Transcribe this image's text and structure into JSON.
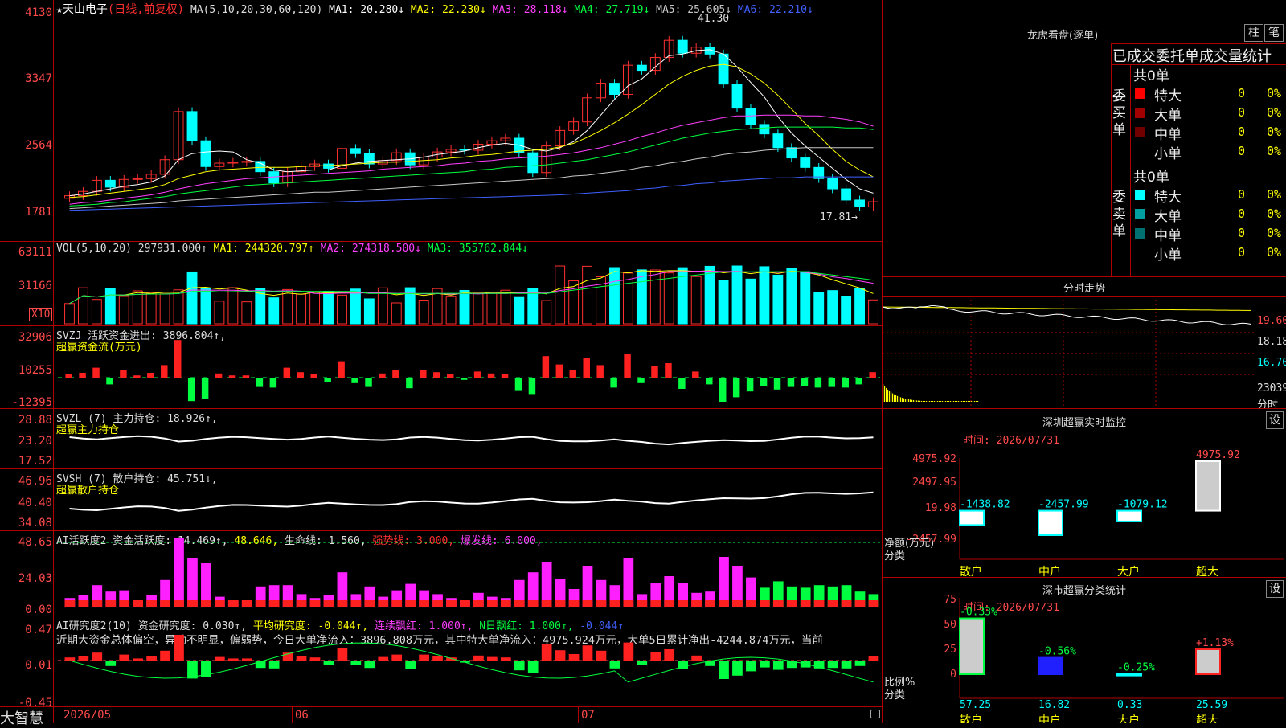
{
  "stock": {
    "star": "★",
    "name": "天山电子",
    "mode": "(日线,前复权)"
  },
  "ma_header": {
    "prefix": "MA(5,10,20,30,60,120)",
    "items": [
      {
        "label": "MA1: 20.280↓",
        "color": "#ffffff"
      },
      {
        "label": "MA2: 22.230↓",
        "color": "#ffff00"
      },
      {
        "label": "MA3: 28.118↓",
        "color": "#ff40ff"
      },
      {
        "label": "MA4: 27.719↓",
        "color": "#00ff40"
      },
      {
        "label": "MA5: 25.605↓",
        "color": "#c8c8c8"
      },
      {
        "label": "MA6: 22.210↓",
        "color": "#4060ff"
      }
    ]
  },
  "price_axis": [
    "4130",
    "3347",
    "2564",
    "1781"
  ],
  "price_annot": {
    "high": "41.30",
    "low": "17.81→"
  },
  "vol_header": {
    "prefix": "VOL(5,10,20)",
    "value": "297931.000↑",
    "items": [
      {
        "label": "MA1: 244320.797↑",
        "color": "#ffff00"
      },
      {
        "label": "MA2: 274318.500↓",
        "color": "#ff40ff"
      },
      {
        "label": "MA3: 355762.844↓",
        "color": "#00ff40"
      }
    ]
  },
  "vol_axis": [
    "63111",
    "31166"
  ],
  "vol_unit": "X10",
  "svzj": {
    "title": "SVZJ  活跃资金进出: 3896.804↑,",
    "sub": "超赢资金流(万元)",
    "axis": [
      "32906",
      "10255",
      "-12395"
    ]
  },
  "svzl": {
    "title": "SVZL (7) 主力持仓: 18.926↑,",
    "sub": "超赢主力持仓",
    "axis": [
      "28.88",
      "23.20",
      "17.52"
    ]
  },
  "svsh": {
    "title": "SVSH (7) 散户持仓: 45.751↓,",
    "sub": "超赢散户持仓",
    "axis": [
      "46.96",
      "40.40",
      "34.08"
    ]
  },
  "ai2": {
    "items": [
      {
        "label": "AI活跃度2 资金活跃度: 14.469↑,",
        "color": "#dddddd"
      },
      {
        "label": "48.646,",
        "color": "#ffff00"
      },
      {
        "label": "生命线: 1.560,",
        "color": "#dddddd"
      },
      {
        "label": "强势线: 3.000,",
        "color": "#ff3030"
      },
      {
        "label": "爆发线: 6.000,",
        "color": "#ff40ff"
      }
    ],
    "axis": [
      "48.65",
      "24.03",
      "0.00"
    ]
  },
  "ai_res": {
    "items": [
      {
        "label": "AI研究度2(10) 资金研究度: 0.030↑,",
        "color": "#dddddd"
      },
      {
        "label": "平均研究度: -0.044↑,",
        "color": "#ffff00"
      },
      {
        "label": "连续飘红: 1.000↑,",
        "color": "#ff40ff"
      },
      {
        "label": "N日飘红: 1.000↑,",
        "color": "#00ff40"
      },
      {
        "label": "-0.044↑",
        "color": "#4060ff"
      }
    ],
    "text": "近期大资金总体偏空，异动不明显，偏弱势，今日大单净流入：3896.808万元，其中特大单净流入：4975.924万元，大单5日累计净出-4244.874万元，当前",
    "axis": [
      "0.47",
      "0.01",
      "-0.45"
    ]
  },
  "bottom": {
    "brand": "大智慧",
    "dates": [
      "2026/05",
      "06",
      "07"
    ]
  },
  "lhb": {
    "title": "龙虎看盘(逐单)",
    "btn1": "柱",
    "btn2": "笔",
    "subtitle": "已成交委托单成交量统计",
    "buy": {
      "side": "委买单",
      "total": "共0单",
      "rows": [
        {
          "label": "特大",
          "val": "0",
          "pct": "0%",
          "color": "#ff0000"
        },
        {
          "label": "大单",
          "val": "0",
          "pct": "0%",
          "color": "#a00000"
        },
        {
          "label": "中单",
          "val": "0",
          "pct": "0%",
          "color": "#700000"
        },
        {
          "label": "小单",
          "val": "0",
          "pct": "0%",
          "color": "#000000"
        }
      ]
    },
    "sell": {
      "side": "委卖单",
      "total": "共0单",
      "rows": [
        {
          "label": "特大",
          "val": "0",
          "pct": "0%",
          "color": "#00ffff"
        },
        {
          "label": "大单",
          "val": "0",
          "pct": "0%",
          "color": "#00a0a0"
        },
        {
          "label": "中单",
          "val": "0",
          "pct": "0%",
          "color": "#007070"
        },
        {
          "label": "小单",
          "val": "0",
          "pct": "0%",
          "color": "#000000"
        }
      ]
    }
  },
  "intraday": {
    "title": "分时走势",
    "axis": [
      "19.60",
      "18.18",
      "16.70"
    ],
    "vol": "23039",
    "vol_label": "分时"
  },
  "sz_monitor": {
    "title": "深圳超赢实时监控",
    "btn": "设",
    "time": "时间: 2026/07/31",
    "axis": [
      "4975.92",
      "2497.95",
      "19.98",
      "-2457.99"
    ],
    "ylabel": "净额(万元)",
    "xlabel": "分类",
    "bars": [
      {
        "cat": "散户",
        "value": -1438.82,
        "label": "-1438.82"
      },
      {
        "cat": "中户",
        "value": -2457.99,
        "label": "-2457.99"
      },
      {
        "cat": "大户",
        "value": -1079.12,
        "label": "-1079.12"
      },
      {
        "cat": "超大",
        "value": 4975.92,
        "label": "4975.92"
      }
    ]
  },
  "sz_class": {
    "title": "深市超赢分类统计",
    "btn": "设",
    "time": "时间: 2026/07/31",
    "axis": [
      "75",
      "50",
      "25",
      "0"
    ],
    "ylabel": "比例%",
    "xlabel": "分类",
    "bars": [
      {
        "cat": "散户",
        "value": 57.25,
        "label": "57.25",
        "chg": "-0.33%"
      },
      {
        "cat": "中户",
        "value": 16.82,
        "label": "16.82",
        "chg": "-0.56%"
      },
      {
        "cat": "大户",
        "value": 0.33,
        "label": "0.33",
        "chg": "-0.25%"
      },
      {
        "cat": "超大",
        "value": 25.59,
        "label": "25.59",
        "chg": "+1.13%"
      }
    ]
  },
  "chart_data": [
    {
      "type": "bar",
      "title": "深圳超赢实时监控",
      "ylabel": "净额(万元)",
      "xlabel": "分类",
      "categories": [
        "散户",
        "中户",
        "大户",
        "超大"
      ],
      "values": [
        -1438.82,
        -2457.99,
        -1079.12,
        4975.92
      ],
      "ylim": [
        -2457.99,
        4975.92
      ]
    },
    {
      "type": "bar",
      "title": "深市超赢分类统计",
      "ylabel": "比例%",
      "xlabel": "分类",
      "categories": [
        "散户",
        "中户",
        "大户",
        "超大"
      ],
      "values": [
        57.25,
        16.82,
        0.33,
        25.59
      ],
      "ylim": [
        0,
        75
      ]
    },
    {
      "type": "candlestick",
      "price_axis_ticks": [
        41.3,
        33.47,
        25.64,
        17.81
      ],
      "close": [
        20.0,
        20.5,
        21.8,
        21.0,
        21.9,
        22.0,
        22.5,
        24.2,
        29.8,
        26.4,
        23.4,
        23.8,
        23.9,
        24.0,
        22.8,
        21.5,
        22.8,
        23.4,
        23.7,
        23.2,
        25.5,
        24.9,
        23.7,
        24.1,
        25.0,
        23.6,
        24.5,
        25.1,
        25.4,
        25.3,
        26.0,
        26.4,
        26.7,
        25.0,
        22.7,
        25.8,
        27.6,
        28.6,
        31.4,
        33.1,
        31.8,
        35.2,
        34.6,
        36.1,
        38.1,
        36.6,
        37.3,
        36.5,
        33.0,
        30.2,
        28.3,
        27.2,
        25.6,
        24.4,
        23.3,
        22.0,
        20.8,
        19.5,
        18.7,
        19.3
      ],
      "ma1": [
        20.0,
        20.2,
        20.5,
        20.8,
        21.1,
        21.3,
        21.6,
        22.3,
        24.2,
        24.9,
        25.1,
        25.2,
        25.1,
        24.2,
        23.8,
        23.0,
        22.8,
        22.9,
        23.0,
        23.0,
        23.5,
        23.8,
        24.0,
        24.1,
        24.2,
        24.3,
        24.5,
        24.8,
        25.0,
        25.2,
        25.6,
        25.9,
        26.1,
        25.9,
        25.4,
        25.2,
        25.6,
        26.3,
        27.6,
        29.4,
        31.2,
        32.8,
        33.6,
        35.0,
        36.3,
        36.5,
        36.9,
        37.0,
        36.5,
        35.0,
        33.2,
        31.5,
        29.2,
        27.3,
        25.8,
        24.5,
        23.2,
        21.9,
        20.8,
        20.3
      ],
      "ma2": [
        19.8,
        19.9,
        20.1,
        20.3,
        20.5,
        20.7,
        20.9,
        21.3,
        22.0,
        22.4,
        22.8,
        23.0,
        23.1,
        23.2,
        23.3,
        23.3,
        23.3,
        23.4,
        23.5,
        23.5,
        23.6,
        23.7,
        23.8,
        23.9,
        23.9,
        24.0,
        24.1,
        24.2,
        24.4,
        24.5,
        24.7,
        24.8,
        25.0,
        25.2,
        25.3,
        25.4,
        25.7,
        26.1,
        26.8,
        27.6,
        28.5,
        29.5,
        30.6,
        31.8,
        33.0,
        33.9,
        34.6,
        35.1,
        35.3,
        35.0,
        34.2,
        33.1,
        31.7,
        30.1,
        28.4,
        27.0,
        25.4,
        24.0,
        23.0,
        22.2
      ],
      "ma3": [
        19.0,
        19.2,
        19.3,
        19.5,
        19.7,
        19.9,
        20.1,
        20.4,
        20.8,
        21.1,
        21.4,
        21.6,
        21.8,
        22.0,
        22.1,
        22.2,
        22.3,
        22.4,
        22.5,
        22.6,
        22.7,
        22.8,
        22.9,
        23.1,
        23.2,
        23.3,
        23.4,
        23.5,
        23.7,
        23.8,
        24.0,
        24.1,
        24.3,
        24.4,
        24.5,
        24.6,
        24.8,
        25.0,
        25.3,
        25.6,
        26.0,
        26.4,
        26.9,
        27.3,
        27.8,
        28.2,
        28.5,
        28.8,
        29.1,
        29.3,
        29.3,
        29.4,
        29.4,
        29.4,
        29.3,
        29.3,
        29.1,
        28.9,
        28.6,
        28.1
      ],
      "ma4": [
        18.8,
        18.9,
        19.0,
        19.2,
        19.3,
        19.5,
        19.7,
        19.9,
        20.2,
        20.4,
        20.6,
        20.8,
        21.0,
        21.2,
        21.3,
        21.4,
        21.5,
        21.6,
        21.7,
        21.8,
        21.9,
        22.0,
        22.1,
        22.2,
        22.3,
        22.4,
        22.5,
        22.6,
        22.7,
        22.8,
        23.0,
        23.1,
        23.3,
        23.4,
        23.5,
        23.6,
        23.8,
        24.0,
        24.2,
        24.5,
        24.8,
        25.1,
        25.5,
        25.9,
        26.3,
        26.7,
        27.0,
        27.3,
        27.5,
        27.7,
        27.8,
        27.9,
        28.0,
        28.0,
        28.0,
        28.0,
        28.0,
        27.9,
        27.9,
        27.7
      ],
      "ma5": [
        18.5,
        18.6,
        18.7,
        18.8,
        18.9,
        19.0,
        19.1,
        19.2,
        19.4,
        19.5,
        19.6,
        19.7,
        19.8,
        19.9,
        20.0,
        20.1,
        20.2,
        20.3,
        20.4,
        20.4,
        20.5,
        20.6,
        20.7,
        20.8,
        20.9,
        21.0,
        21.1,
        21.2,
        21.3,
        21.4,
        21.5,
        21.6,
        21.7,
        21.8,
        21.9,
        22.0,
        22.1,
        22.3,
        22.4,
        22.6,
        22.8,
        23.0,
        23.3,
        23.5,
        23.8,
        24.0,
        24.3,
        24.5,
        24.8,
        25.0,
        25.1,
        25.3,
        25.4,
        25.5,
        25.6,
        25.6,
        25.6,
        25.6,
        25.6,
        25.6
      ],
      "ma6": [
        18.3,
        18.35,
        18.4,
        18.45,
        18.5,
        18.55,
        18.6,
        18.65,
        18.7,
        18.75,
        18.8,
        18.85,
        18.9,
        18.95,
        19.0,
        19.05,
        19.1,
        19.15,
        19.2,
        19.25,
        19.3,
        19.35,
        19.4,
        19.45,
        19.5,
        19.55,
        19.6,
        19.65,
        19.7,
        19.75,
        19.8,
        19.85,
        19.9,
        19.95,
        20.0,
        20.05,
        20.1,
        20.2,
        20.3,
        20.4,
        20.5,
        20.6,
        20.8,
        20.9,
        21.1,
        21.2,
        21.4,
        21.5,
        21.7,
        21.8,
        21.9,
        22.0,
        22.1,
        22.1,
        22.2,
        22.2,
        22.2,
        22.2,
        22.2,
        22.2
      ]
    }
  ]
}
